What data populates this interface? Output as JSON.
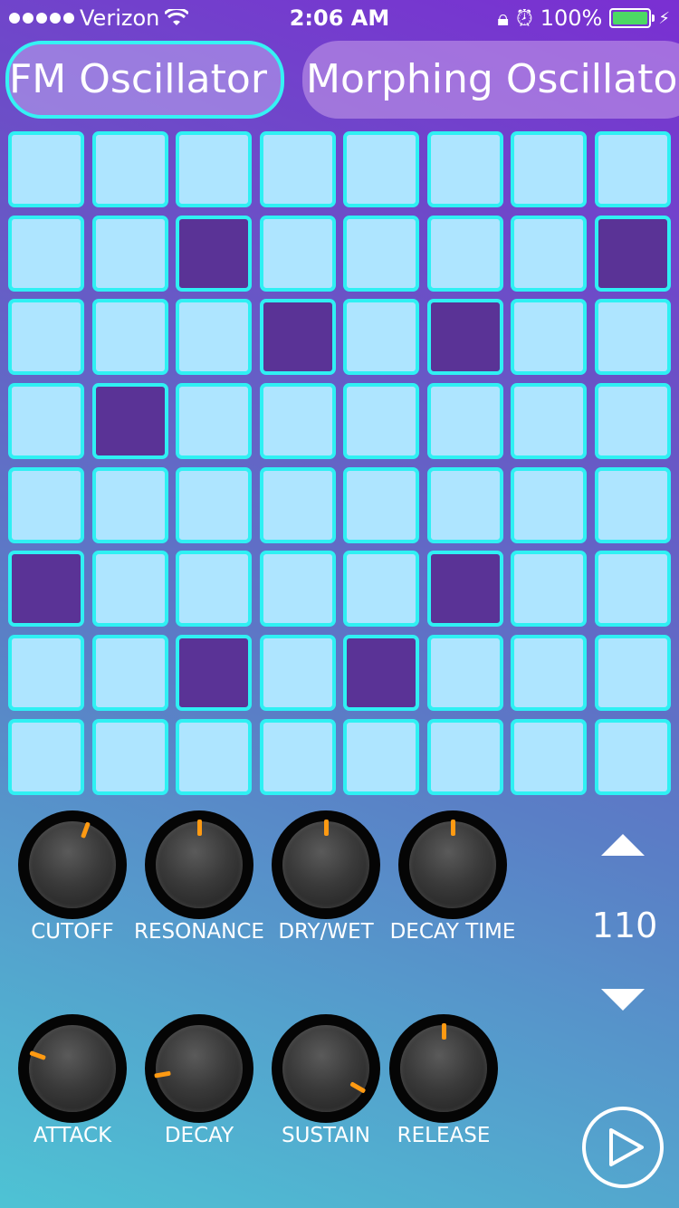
{
  "status_bar": {
    "carrier": "Verizon",
    "time": "2:06 AM",
    "battery": "100%"
  },
  "tabs": [
    {
      "label": "FM Oscillator",
      "selected": true
    },
    {
      "label": "Morphing Oscillator",
      "selected": false
    }
  ],
  "grid": {
    "rows": 8,
    "cols": 8,
    "active_cells": [
      [
        1,
        2
      ],
      [
        1,
        7
      ],
      [
        2,
        3
      ],
      [
        2,
        5
      ],
      [
        3,
        1
      ],
      [
        5,
        0
      ],
      [
        5,
        5
      ],
      [
        6,
        2
      ],
      [
        6,
        4
      ]
    ]
  },
  "knobs_row1": [
    {
      "label": "CUTOFF",
      "value_deg": 20
    },
    {
      "label": "RESONANCE",
      "value_deg": 0
    },
    {
      "label": "DRY/WET",
      "value_deg": 0
    },
    {
      "label": "DECAY TIME",
      "value_deg": 0
    }
  ],
  "knobs_row2": [
    {
      "label": "ATTACK",
      "value_deg": -70
    },
    {
      "label": "DECAY",
      "value_deg": -100
    },
    {
      "label": "SUSTAIN",
      "value_deg": 120
    },
    {
      "label": "RELEASE",
      "value_deg": 0
    }
  ],
  "tempo": {
    "value": "110"
  },
  "colors": {
    "cell_off": "#aee5ff",
    "cell_on": "#5a3396",
    "cell_border": "#2ff0f3",
    "knob_indicator": "#ff9a12"
  }
}
